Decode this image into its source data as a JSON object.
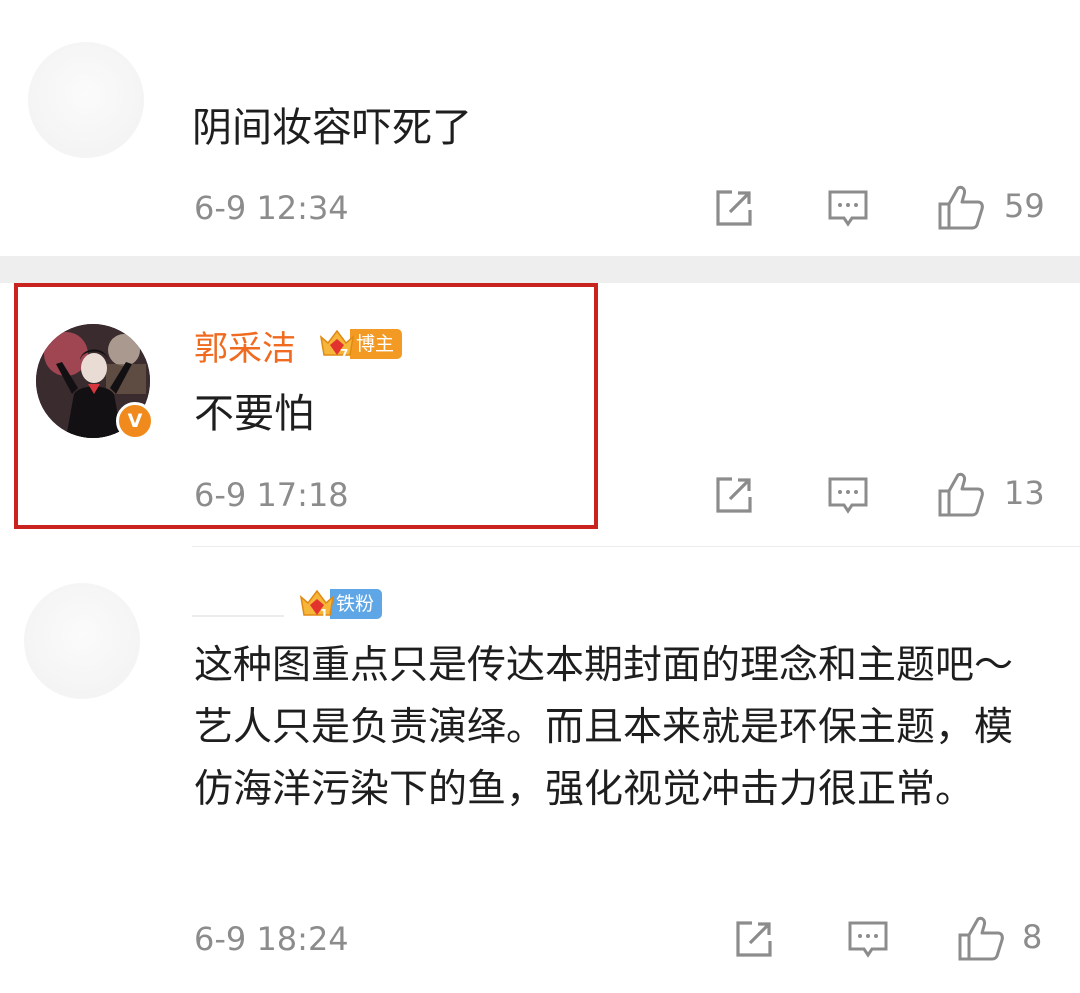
{
  "comments": [
    {
      "text": "阴间妆容吓死了",
      "time": "6-9 12:34",
      "likes": "59",
      "icons": [
        "share-icon",
        "reply-icon",
        "like-icon"
      ]
    },
    {
      "username": "郭采洁",
      "badge": "博主",
      "badge_level": "7",
      "verified_mark": "V",
      "text": "不要怕",
      "time": "6-9 17:18",
      "likes": "13",
      "highlighted": true,
      "highlight_color": "#c8231e",
      "icons": [
        "share-icon",
        "reply-icon",
        "like-icon"
      ]
    },
    {
      "badge": "铁粉",
      "badge_level": "1",
      "text": "这种图重点只是传达本期封面的理念和主题吧～ 艺人只是负责演绎。而且本来就是环保主题，模仿海洋污染下的鱼，强化视觉冲击力很正常。",
      "time": "6-9 18:24",
      "likes": "8",
      "icons": [
        "share-icon",
        "reply-icon",
        "like-icon"
      ]
    }
  ],
  "colors": {
    "username": "#f06a1f",
    "time": "#8c8c8c",
    "bozhu_badge": "#f39a24",
    "tiefen_badge": "#5fa6e6",
    "icon_gray": "#8c8c8c",
    "verified": "#f08a1c"
  }
}
